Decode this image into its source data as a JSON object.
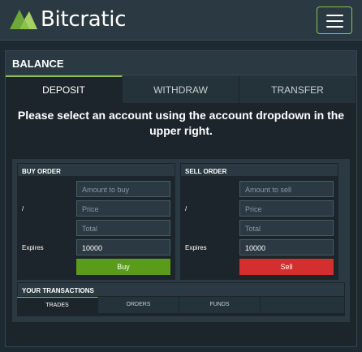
{
  "header": {
    "logo_text": "Bitcratic"
  },
  "panel": {
    "title": "BALANCE",
    "tabs": [
      {
        "label": "DEPOSIT",
        "active": true
      },
      {
        "label": "WITHDRAW",
        "active": false
      },
      {
        "label": "TRANSFER",
        "active": false
      }
    ],
    "notice": "Please select an account using the account dropdown in the upper right."
  },
  "buy_order": {
    "title": "BUY ORDER",
    "pair_label": "/",
    "amount_placeholder": "Amount to buy",
    "price_placeholder": "Price",
    "total_placeholder": "Total",
    "expires_label": "Expires",
    "expires_value": "10000",
    "button_label": "Buy"
  },
  "sell_order": {
    "title": "SELL ORDER",
    "pair_label": "/",
    "amount_placeholder": "Amount to sell",
    "price_placeholder": "Price",
    "total_placeholder": "Total",
    "expires_label": "Expires",
    "expires_value": "10000",
    "button_label": "Sell"
  },
  "transactions": {
    "title": "YOUR TRANSACTIONS",
    "tabs": [
      {
        "label": "TRADES",
        "active": true
      },
      {
        "label": "ORDERS",
        "active": false
      },
      {
        "label": "FUNDS",
        "active": false
      }
    ]
  },
  "colors": {
    "accent": "#8bc34a",
    "buy": "#5a9b1a",
    "sell": "#d32f2f",
    "background": "#1e2a31"
  }
}
